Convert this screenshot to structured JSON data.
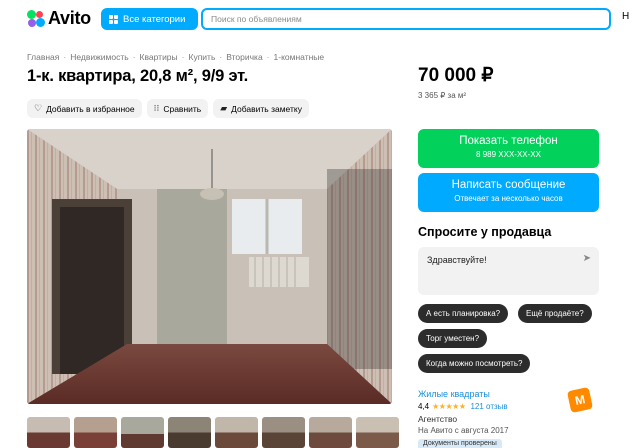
{
  "header": {
    "logo_text": "Avito",
    "categories_label": "Все категории",
    "search_placeholder": "Поиск по объявлениям",
    "accent": "#00aaff"
  },
  "breadcrumb": [
    "Главная",
    "Недвижимость",
    "Квартиры",
    "Купить",
    "Вторичка",
    "1-комнатные"
  ],
  "listing": {
    "title": "1-к. квартира, 20,8 м², 9/9 эт.",
    "price": "70 000 ₽",
    "price_per_m": "3 365 ₽ за м²"
  },
  "actions": {
    "favorite": "Добавить в избранное",
    "compare": "Сравнить",
    "note": "Добавить заметку"
  },
  "contact": {
    "phone_label": "Показать телефон",
    "phone_masked": "8 989 XXX-XX-XX",
    "message_label": "Написать сообщение",
    "message_sub": "Отвечает за несколько часов",
    "phone_color": "#02d15c"
  },
  "ask": {
    "title": "Спросите у продавца",
    "input_value": "Здравствуйте!",
    "chips": [
      "А есть планировка?",
      "Ещё продаёте?",
      "Торг уместен?",
      "Когда можно посмотреть?"
    ]
  },
  "seller": {
    "name": "Жилые квадраты",
    "rating": "4,4",
    "stars": "★★★★★",
    "reviews": "121 отзыв",
    "type": "Агентство",
    "since": "На Авито с августа 2017",
    "badge": "Документы проверены"
  }
}
